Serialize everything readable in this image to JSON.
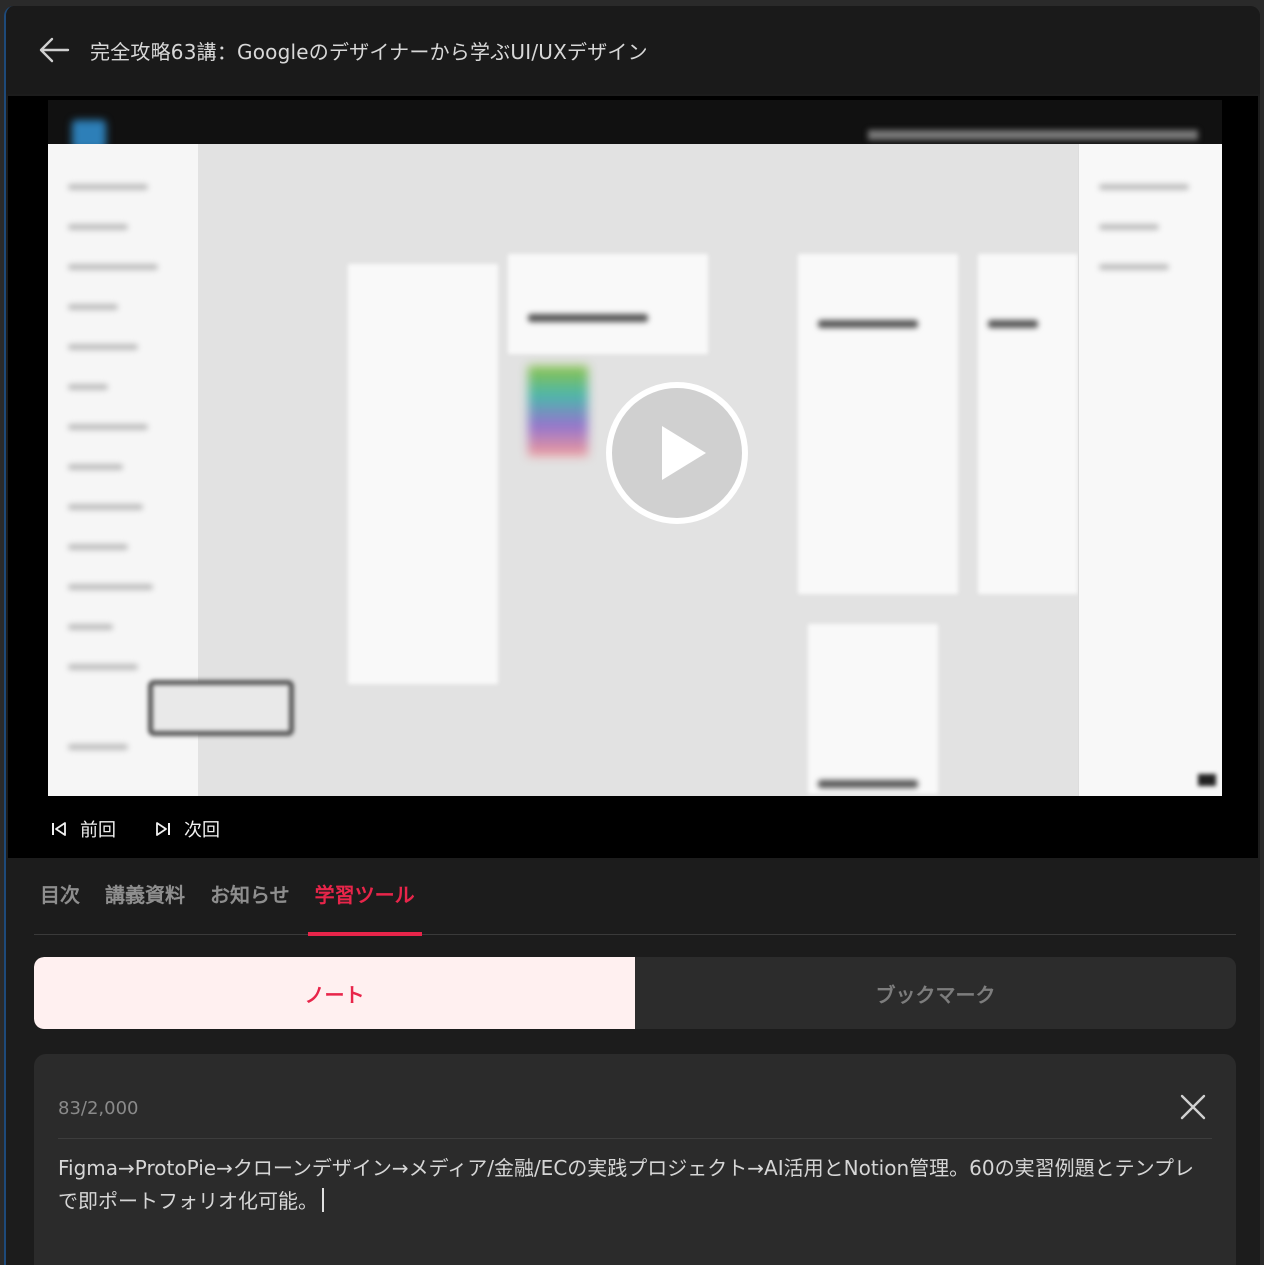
{
  "header": {
    "title": "完全攻略63講：Googleのデザイナーから学ぶUI/UXデザイン"
  },
  "player": {
    "prev_label": "前回",
    "next_label": "次回"
  },
  "tabs": [
    {
      "label": "目次",
      "active": false
    },
    {
      "label": "講義資料",
      "active": false
    },
    {
      "label": "お知らせ",
      "active": false
    },
    {
      "label": "学習ツール",
      "active": true
    }
  ],
  "segments": {
    "note_label": "ノート",
    "bookmark_label": "ブックマーク",
    "selected": "note"
  },
  "note": {
    "counter": "83/2,000",
    "text": "Figma→ProtoPie→クローンデザイン→メディア/金融/ECの実践プロジェクト→AI活用とNotion管理。60の実習例題とテンプレで即ポートフォリオ化可能。"
  },
  "colors": {
    "accent": "#e8254a",
    "background": "#1c1c1c",
    "segment_active_bg": "#fff0f0"
  },
  "icons": {
    "back": "arrow-left-icon",
    "play": "play-icon",
    "prev": "skip-previous-icon",
    "next": "skip-next-icon",
    "close": "close-icon"
  }
}
